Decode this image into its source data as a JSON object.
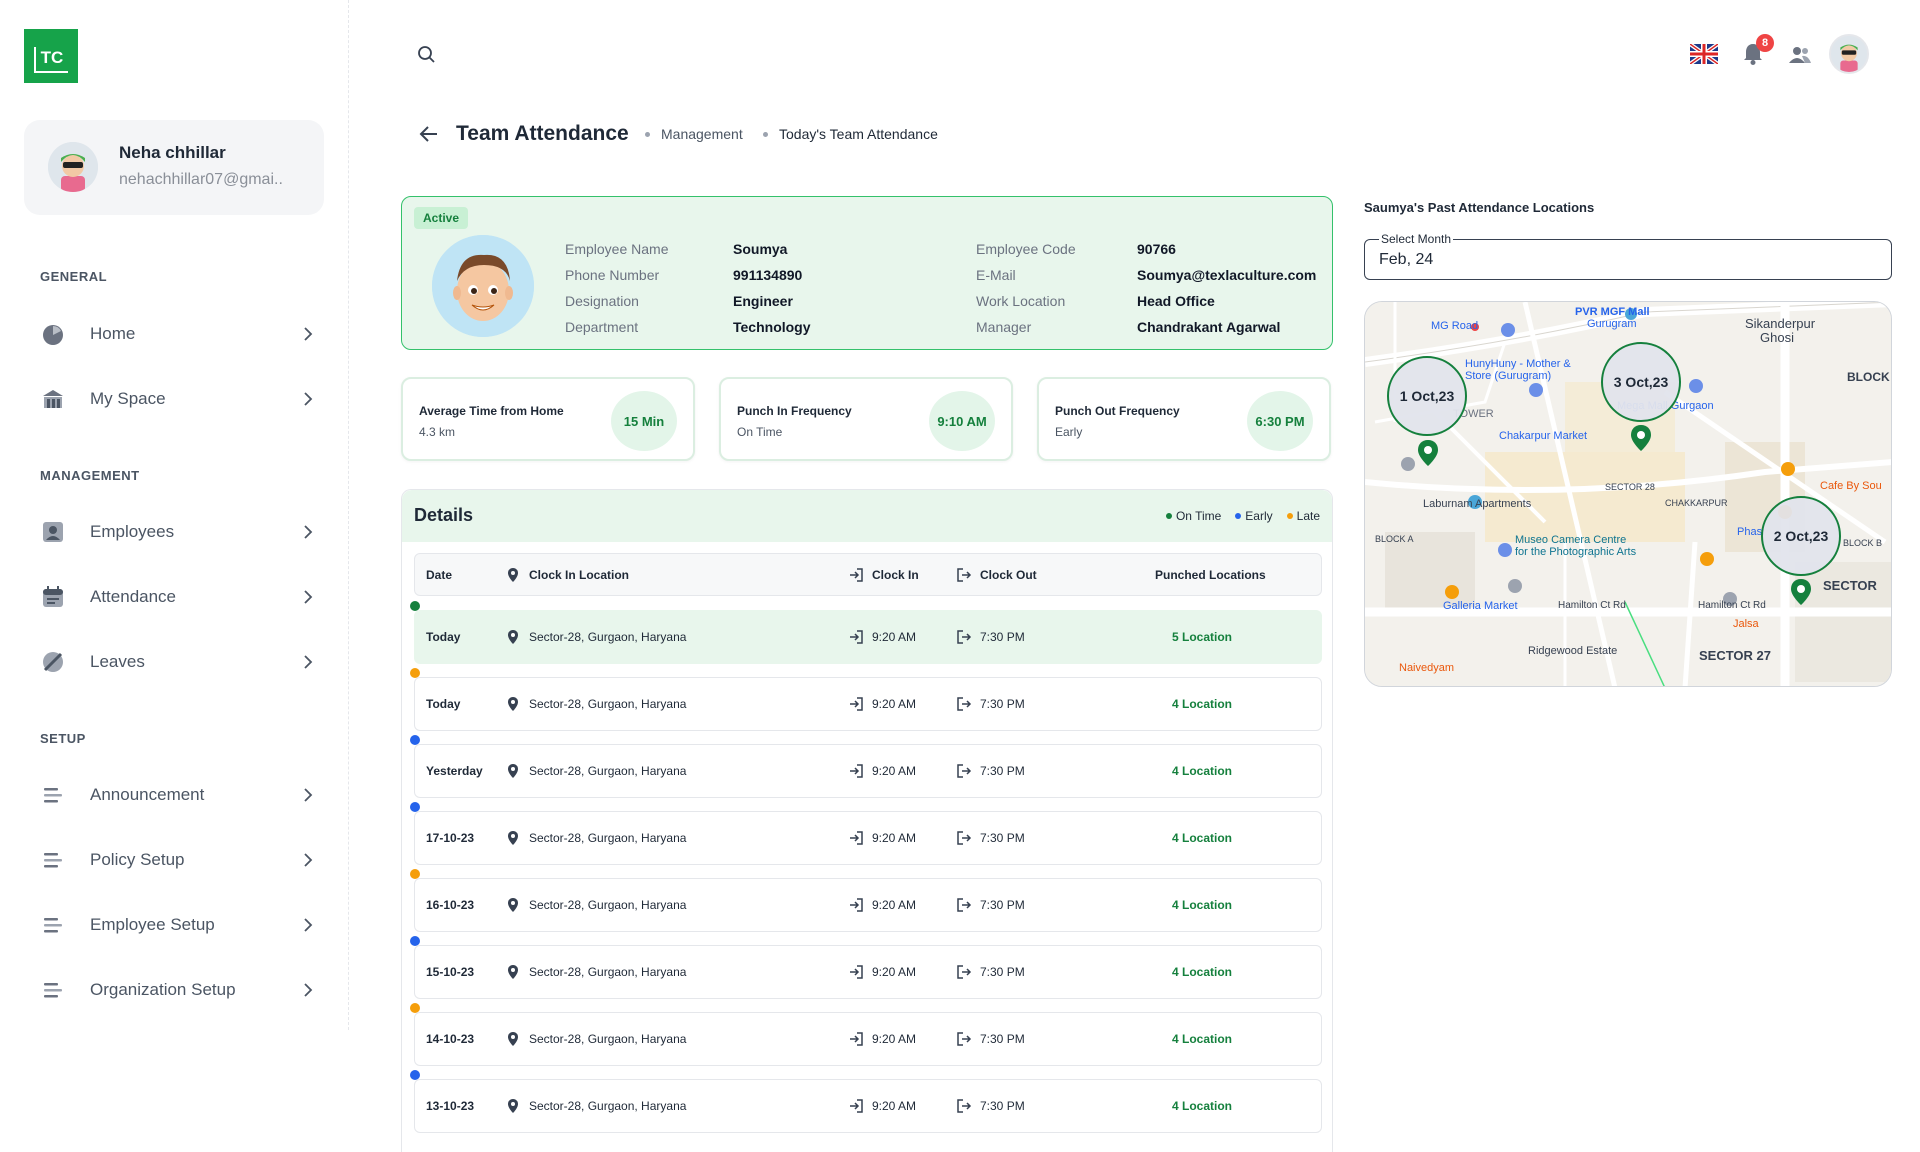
{
  "logo": {
    "text": "TC"
  },
  "profile": {
    "name": "Neha chhillar",
    "email": "nehachhillar07@gmai.."
  },
  "sections": {
    "general": "GENERAL",
    "management": "MANAGEMENT",
    "setup": "SETUP"
  },
  "nav": {
    "home": "Home",
    "my_space": "My Space",
    "employees": "Employees",
    "attendance": "Attendance",
    "leaves": "Leaves",
    "announcement": "Announcement",
    "policy_setup": "Policy Setup",
    "employee_setup": "Employee Setup",
    "organization_setup": "Organization Setup"
  },
  "topbar": {
    "notification_count": "8"
  },
  "header": {
    "title": "Team Attendance",
    "breadcrumb": [
      "Management",
      "Today's Team Attendance"
    ]
  },
  "employee": {
    "status": "Active",
    "labels": {
      "name": "Employee Name",
      "phone": "Phone Number",
      "designation": "Designation",
      "department": "Department",
      "code": "Employee Code",
      "email": "E-Mail",
      "work_location": "Work Location",
      "manager": "Manager"
    },
    "values": {
      "name": "Soumya",
      "phone": "991134890",
      "designation": "Engineer",
      "department": "Technology",
      "code": "90766",
      "email": "Soumya@texlaculture.com",
      "work_location": "Head Office",
      "manager": "Chandrakant Agarwal"
    }
  },
  "stats": [
    {
      "title": "Average Time from Home",
      "sub": "4.3 km",
      "value": "15 Min"
    },
    {
      "title": "Punch In Frequency",
      "sub": "On Time",
      "value": "9:10 AM"
    },
    {
      "title": "Punch Out Frequency",
      "sub": "Early",
      "value": "6:30 PM"
    }
  ],
  "details": {
    "title": "Details",
    "legend": {
      "on_time": "On Time",
      "early": "Early",
      "late": "Late"
    },
    "columns": {
      "date": "Date",
      "clock_in_location": "Clock In Location",
      "clock_in": "Clock In",
      "clock_out": "Clock Out",
      "punched": "Punched Locations"
    },
    "rows": [
      {
        "date": "Today",
        "location": "Sector-28, Gurgaon, Haryana",
        "clock_in": "9:20 AM",
        "clock_out": "7:30 PM",
        "punched": "5 Location",
        "status": "on_time"
      },
      {
        "date": "Today",
        "location": "Sector-28, Gurgaon, Haryana",
        "clock_in": "9:20 AM",
        "clock_out": "7:30 PM",
        "punched": "4 Location",
        "status": "late"
      },
      {
        "date": "Yesterday",
        "location": "Sector-28, Gurgaon, Haryana",
        "clock_in": "9:20 AM",
        "clock_out": "7:30 PM",
        "punched": "4 Location",
        "status": "early"
      },
      {
        "date": "17-10-23",
        "location": "Sector-28, Gurgaon, Haryana",
        "clock_in": "9:20 AM",
        "clock_out": "7:30 PM",
        "punched": "4 Location",
        "status": "early"
      },
      {
        "date": "16-10-23",
        "location": "Sector-28, Gurgaon, Haryana",
        "clock_in": "9:20 AM",
        "clock_out": "7:30 PM",
        "punched": "4 Location",
        "status": "late"
      },
      {
        "date": "15-10-23",
        "location": "Sector-28, Gurgaon, Haryana",
        "clock_in": "9:20 AM",
        "clock_out": "7:30 PM",
        "punched": "4 Location",
        "status": "early"
      },
      {
        "date": "14-10-23",
        "location": "Sector-28, Gurgaon, Haryana",
        "clock_in": "9:20 AM",
        "clock_out": "7:30 PM",
        "punched": "4 Location",
        "status": "late"
      },
      {
        "date": "13-10-23",
        "location": "Sector-28, Gurgaon, Haryana",
        "clock_in": "9:20 AM",
        "clock_out": "7:30 PM",
        "punched": "4 Location",
        "status": "early"
      }
    ]
  },
  "map_panel": {
    "title": "Saumya's Past Attendance Locations",
    "select_label": "Select Month",
    "select_value": "Feb, 24",
    "bubbles": [
      "1 Oct,23",
      "3 Oct,23",
      "2 Oct,23"
    ],
    "places": {
      "mg_road": "MG Road",
      "pvr": "PVR MGF Mall",
      "gurugram": "Gurugram",
      "sikanderpur": "Sikanderpur",
      "ghosi": "Ghosi",
      "hunyhuny": "HunyHuny - Mother &",
      "store": "Store (Gurugram)",
      "tower": "TOWER",
      "mega_mall": "Mega Mall Gurgaon",
      "chakarpur_market": "Chakarpur Market",
      "laburnam": "Laburnam Apartments",
      "sector28": "SECTOR 28",
      "chakkarpur": "CHAKKARPUR",
      "museo1": "Museo Camera Centre",
      "museo2": "for the Photographic Arts",
      "block_a": "BLOCK A",
      "galleria": "Galleria Market",
      "hamilton1": "Hamilton Ct Rd",
      "hamilton2": "Hamilton Ct Rd",
      "ridgewood": "Ridgewood Estate",
      "sector27": "SECTOR 27",
      "naivedyam": "Naivedyam",
      "jalsa": "Jalsa",
      "cafe": "Cafe By Sou",
      "block_right": "BLOCK",
      "sector_right": "SECTOR",
      "phase": "Phas",
      "block_b": "BLOCK B"
    }
  },
  "colors": {
    "on_time": "#15803d",
    "early": "#2563eb",
    "late": "#f59e0b",
    "accent": "#16a34a"
  }
}
